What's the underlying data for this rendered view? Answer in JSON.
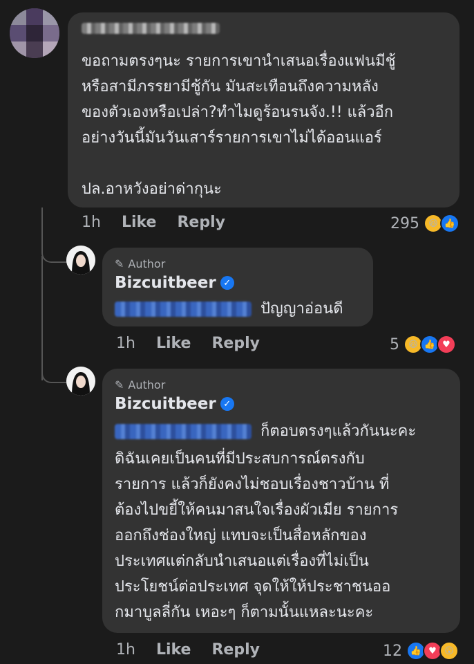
{
  "comment1": {
    "text": "ขอถามตรงๆนะ  รายการเขานำเสนอเรื่องแฟนมีชู้\nหรือสามีภรรยามีชู้กัน มันสะเทือนถึงความหลัง\nของตัวเองหรือเปล่า?ทำไมดูร้อนรนจัง.!!  แล้วอีก\nอย่างวันนี้มันวันเสาร์รายการเขาไม่ได้ออนแอร์\n\nปล.อาหวังอย่าด่ากุนะ",
    "time": "1h",
    "like": "Like",
    "reply": "Reply",
    "reaction_count": "295"
  },
  "reply1": {
    "badge": "Author",
    "name": "Bizcuitbeer",
    "text": "ปัญญาอ่อนดี",
    "time": "1h",
    "like": "Like",
    "reply": "Reply",
    "reaction_count": "5"
  },
  "reply2": {
    "badge": "Author",
    "name": "Bizcuitbeer",
    "first_line": "ก็ตอบตรงๆแล้วกันนะคะ",
    "text": "ดิฉันเคยเป็นคนที่มีประสบการณ์ตรงกับ\nรายการ แล้วก็ยังคงไม่ชอบเรื่องชาวบ้าน ที่\nต้องไปขยี้ให้คนมาสนใจเรื่องผัวเมีย รายการ\nออกถึงช่องใหญ่ แทบจะเป็นสื่อหลักของ\nประเทศแต่กลับนำเสนอแต่เรื่องที่ไม่เป็น\nประโยชน์ต่อประเทศ จุดให้ให้ประชาชนออ\nกมาบูลลี่กัน เหอะๆ ก็ตามนั้นแหละนะคะ",
    "time": "1h",
    "like": "Like",
    "reply": "Reply",
    "reaction_count": "12"
  },
  "colors": {
    "background": "#1b1b1b",
    "bubble": "#333333",
    "like_blue": "#1877f2",
    "love_red": "#f33e58",
    "haha_yellow": "#f7b928"
  }
}
